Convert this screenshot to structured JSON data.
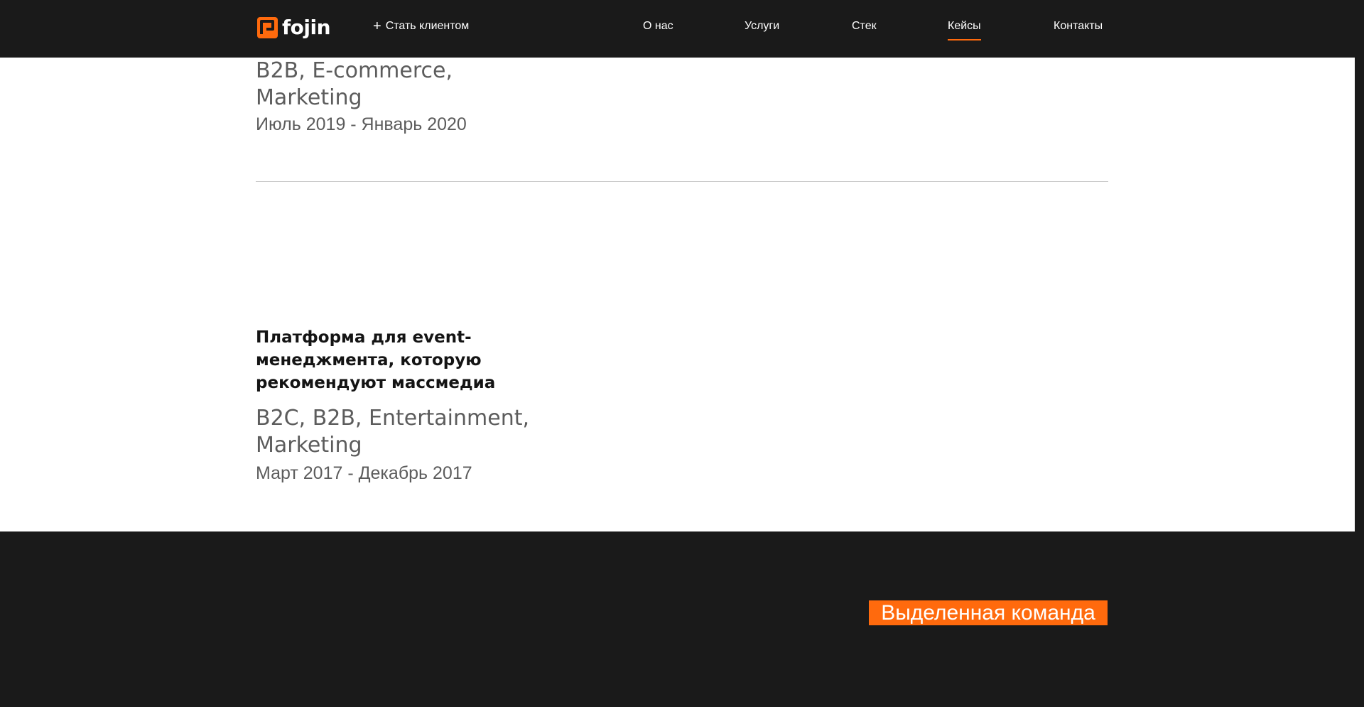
{
  "header": {
    "logo_text": "fojin",
    "become_client_label": "Стать клиентом",
    "nav": [
      {
        "label": "О нас"
      },
      {
        "label": "Услуги"
      },
      {
        "label": "Стек"
      },
      {
        "label": "Кейсы",
        "active": true
      },
      {
        "label": "Контакты"
      }
    ]
  },
  "cases": [
    {
      "tags": "B2B, E-commerce, Marketing",
      "dates": "Июль 2019 - Январь 2020"
    },
    {
      "title": "Платформа для event-менеджмента, которую рекомендуют массмедиа",
      "tags": "B2C, B2B, Entertainment, Marketing",
      "dates": "Март 2017 - Декабрь 2017"
    }
  ],
  "footer": {
    "badge_label": "Выделенная команда"
  },
  "colors": {
    "accent": "#ff6a0d",
    "dark_bg": "#1a1a1a",
    "panel_bg": "#ffffff",
    "muted_text": "#5c5c5c"
  },
  "icons": {
    "logo": "fojin-logo-icon",
    "plus": "plus-icon"
  }
}
